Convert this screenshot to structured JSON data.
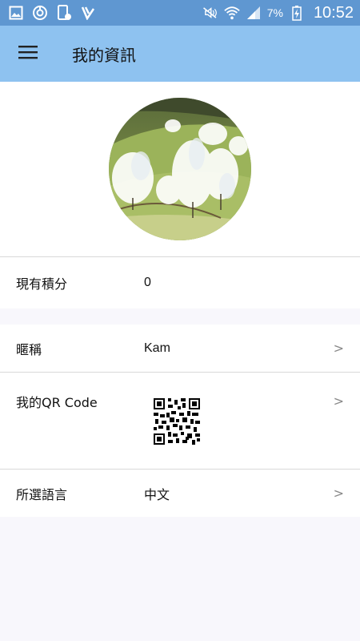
{
  "status_bar": {
    "battery_pct": "7%",
    "time": "10:52"
  },
  "app_bar": {
    "title": "我的資訊"
  },
  "rows": {
    "points": {
      "label": "現有積分",
      "value": "0"
    },
    "nickname": {
      "label": "暱稱",
      "value": "Kam",
      "chevron": ">"
    },
    "qr_code": {
      "label": "我的QR Code",
      "chevron": ">"
    },
    "language": {
      "label": "所選語言",
      "value": "中文",
      "chevron": ">"
    }
  },
  "icons": {
    "menu": "menu-icon",
    "avatar": "profile-photo"
  },
  "colors": {
    "status_bar": "#5f97d1",
    "app_bar": "#8ec2f0",
    "background": "#f8f7fc"
  }
}
